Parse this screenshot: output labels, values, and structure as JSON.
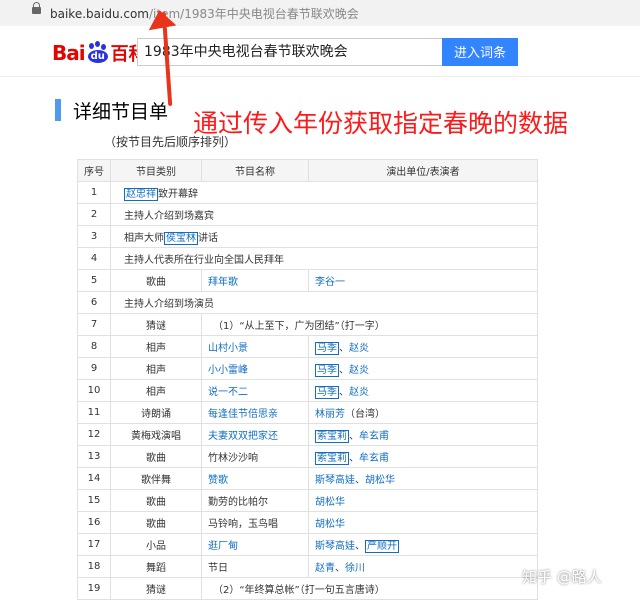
{
  "browser": {
    "url_host": "baike.baidu.com",
    "url_path": "/item/",
    "url_keyword": "1983年中央电视台春节联欢晚会"
  },
  "header": {
    "logo_text": "Bai",
    "logo_du": "du",
    "logo_baike": "百科",
    "search_value": "1983年中央电视台春节联欢晚会",
    "enter_button": "进入词条"
  },
  "annotation": {
    "text": "通过传入年份获取指定春晚的数据",
    "color": "#ff1a1a"
  },
  "section": {
    "title": "详细节目单",
    "subtitle": "（按节目先后顺序排列）"
  },
  "table": {
    "headers": [
      "序号",
      "节目类别",
      "节目名称",
      "演出单位/表演者"
    ],
    "rows": [
      {
        "no": "1",
        "merged": true,
        "parts": [
          {
            "t": "赵忠祥",
            "box": true,
            "link": true
          },
          {
            "t": "致开幕辞"
          }
        ]
      },
      {
        "no": "2",
        "merged": true,
        "parts": [
          {
            "t": "主持人介绍到场嘉宾"
          }
        ]
      },
      {
        "no": "3",
        "merged": true,
        "parts": [
          {
            "t": "相声大师"
          },
          {
            "t": "侯宝林",
            "box": true,
            "link": true
          },
          {
            "t": "讲话"
          }
        ]
      },
      {
        "no": "4",
        "merged": true,
        "parts": [
          {
            "t": "主持人代表所在行业向全国人民拜年"
          }
        ]
      },
      {
        "no": "5",
        "cat": "歌曲",
        "name": [
          {
            "t": "拜年歌",
            "link": true
          }
        ],
        "perf": [
          {
            "t": "李谷一",
            "link": true
          }
        ]
      },
      {
        "no": "6",
        "merged": true,
        "parts": [
          {
            "t": "主持人介绍到场演员"
          }
        ]
      },
      {
        "no": "7",
        "cat": "猜谜",
        "wide": "（1）“从上至下，广为团结”（打一字）"
      },
      {
        "no": "8",
        "cat": "相声",
        "name": [
          {
            "t": "山村小景",
            "link": true
          }
        ],
        "perf": [
          {
            "t": "马季",
            "link": true,
            "box": true
          },
          {
            "t": "、"
          },
          {
            "t": "赵炎",
            "link": true
          }
        ]
      },
      {
        "no": "9",
        "cat": "相声",
        "name": [
          {
            "t": "小小雷峰",
            "link": true
          }
        ],
        "perf": [
          {
            "t": "马季",
            "link": true,
            "box": true
          },
          {
            "t": "、"
          },
          {
            "t": "赵炎",
            "link": true
          }
        ]
      },
      {
        "no": "10",
        "cat": "相声",
        "name": [
          {
            "t": "说一不二",
            "link": true
          }
        ],
        "perf": [
          {
            "t": "马季",
            "link": true,
            "box": true
          },
          {
            "t": "、"
          },
          {
            "t": "赵炎",
            "link": true
          }
        ]
      },
      {
        "no": "11",
        "cat": "诗朗诵",
        "name": [
          {
            "t": "每逢佳节倍思亲",
            "link": true
          }
        ],
        "perf": [
          {
            "t": "林丽芳",
            "link": true
          },
          {
            "t": "（台湾）"
          }
        ]
      },
      {
        "no": "12",
        "cat": "黄梅戏演唱",
        "name": [
          {
            "t": "夫妻双双把家还",
            "link": true
          }
        ],
        "perf": [
          {
            "t": "索宝莉",
            "link": true,
            "box": true
          },
          {
            "t": "、"
          },
          {
            "t": "牟玄甫",
            "link": true
          }
        ]
      },
      {
        "no": "13",
        "cat": "歌曲",
        "name": [
          {
            "t": "竹林沙沙响"
          }
        ],
        "perf": [
          {
            "t": "索宝莉",
            "link": true,
            "box": true
          },
          {
            "t": "、"
          },
          {
            "t": "牟玄甫",
            "link": true
          }
        ]
      },
      {
        "no": "14",
        "cat": "歌伴舞",
        "name": [
          {
            "t": "赞歌",
            "link": true
          }
        ],
        "perf": [
          {
            "t": "斯琴高娃",
            "link": true
          },
          {
            "t": "、"
          },
          {
            "t": "胡松华",
            "link": true
          }
        ]
      },
      {
        "no": "15",
        "cat": "歌曲",
        "name": [
          {
            "t": "勤劳的比帕尔"
          }
        ],
        "perf": [
          {
            "t": "胡松华",
            "link": true
          }
        ]
      },
      {
        "no": "16",
        "cat": "歌曲",
        "name": [
          {
            "t": "马铃响，玉鸟唱"
          }
        ],
        "perf": [
          {
            "t": "胡松华",
            "link": true
          }
        ]
      },
      {
        "no": "17",
        "cat": "小品",
        "name": [
          {
            "t": "逛厂甸",
            "link": true
          }
        ],
        "perf": [
          {
            "t": "斯琴高娃",
            "link": true
          },
          {
            "t": "、"
          },
          {
            "t": "严顺开",
            "link": true,
            "box": true
          }
        ]
      },
      {
        "no": "18",
        "cat": "舞蹈",
        "name": [
          {
            "t": "节日"
          }
        ],
        "perf": [
          {
            "t": "赵青",
            "link": true
          },
          {
            "t": "、"
          },
          {
            "t": "徐川",
            "link": true
          }
        ]
      },
      {
        "no": "19",
        "cat": "猜谜",
        "wide": "（2）“年终算总帐”（打一句五言唐诗）"
      }
    ]
  },
  "watermark": "知乎 @路人"
}
